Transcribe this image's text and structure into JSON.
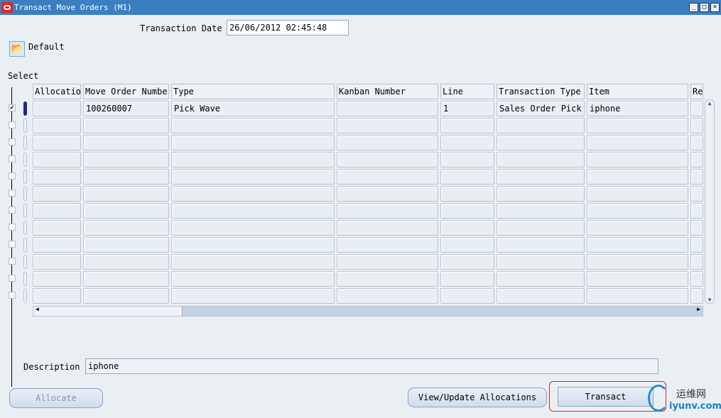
{
  "window": {
    "title": "Transact Move Orders (M1)",
    "controls": [
      "_",
      "□",
      "×"
    ]
  },
  "transaction_date": {
    "label": "Transaction Date",
    "value": "26/06/2012 02:45:48"
  },
  "default_button": {
    "label": "Default",
    "icon": "open-folder-icon"
  },
  "select_label": "Select",
  "table": {
    "columns": [
      "Allocatio",
      "Move Order Number",
      "Type",
      "Kanban Number",
      "Line",
      "Transaction Type",
      "Item",
      "Re"
    ],
    "rows": [
      {
        "selected": true,
        "values": [
          "",
          "100260007",
          "Pick Wave",
          "",
          "1",
          "Sales Order Pick",
          "iphone",
          ""
        ]
      },
      {
        "selected": false,
        "values": [
          "",
          "",
          "",
          "",
          "",
          "",
          "",
          ""
        ]
      },
      {
        "selected": false,
        "values": [
          "",
          "",
          "",
          "",
          "",
          "",
          "",
          ""
        ]
      },
      {
        "selected": false,
        "values": [
          "",
          "",
          "",
          "",
          "",
          "",
          "",
          ""
        ]
      },
      {
        "selected": false,
        "values": [
          "",
          "",
          "",
          "",
          "",
          "",
          "",
          ""
        ]
      },
      {
        "selected": false,
        "values": [
          "",
          "",
          "",
          "",
          "",
          "",
          "",
          ""
        ]
      },
      {
        "selected": false,
        "values": [
          "",
          "",
          "",
          "",
          "",
          "",
          "",
          ""
        ]
      },
      {
        "selected": false,
        "values": [
          "",
          "",
          "",
          "",
          "",
          "",
          "",
          ""
        ]
      },
      {
        "selected": false,
        "values": [
          "",
          "",
          "",
          "",
          "",
          "",
          "",
          ""
        ]
      },
      {
        "selected": false,
        "values": [
          "",
          "",
          "",
          "",
          "",
          "",
          "",
          ""
        ]
      },
      {
        "selected": false,
        "values": [
          "",
          "",
          "",
          "",
          "",
          "",
          "",
          ""
        ]
      },
      {
        "selected": false,
        "values": [
          "",
          "",
          "",
          "",
          "",
          "",
          "",
          ""
        ]
      }
    ]
  },
  "description": {
    "label": "Description",
    "value": "iphone"
  },
  "buttons": {
    "allocate": "Allocate",
    "view_update": "View/Update Allocations",
    "transact": "Transact"
  },
  "watermark": {
    "text1": "运维网",
    "text2": "iyunv.com"
  },
  "colors": {
    "titlebar": "#3a7fc1",
    "highlight": "#e0242a"
  }
}
